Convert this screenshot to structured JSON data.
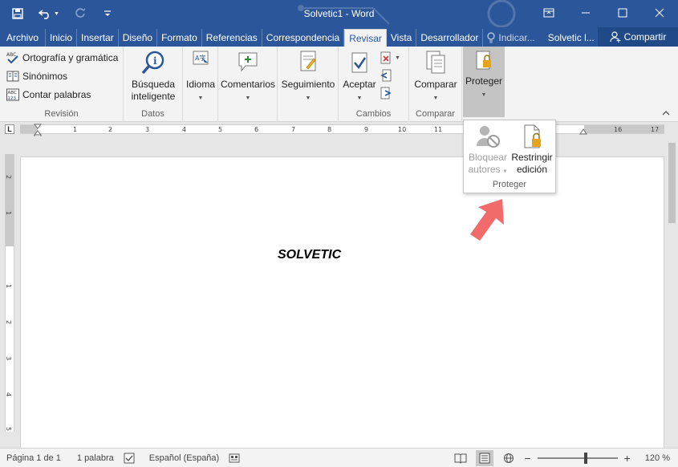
{
  "window": {
    "title": "Solvetic1 - Word"
  },
  "tabs": [
    {
      "label": "Archivo"
    },
    {
      "label": "Inicio"
    },
    {
      "label": "Insertar"
    },
    {
      "label": "Diseño"
    },
    {
      "label": "Formato"
    },
    {
      "label": "Referencias"
    },
    {
      "label": "Correspondencia"
    },
    {
      "label": "Revisar"
    },
    {
      "label": "Vista"
    },
    {
      "label": "Desarrollador"
    }
  ],
  "tell_me": "Indicar...",
  "user_name": "Solvetic l...",
  "share_label": "Compartir",
  "ribbon": {
    "revision": {
      "label": "Revisión",
      "spelling": "Ortografía y gramática",
      "synonyms": "Sinónimos",
      "word_count": "Contar palabras"
    },
    "datos": {
      "label": "Datos",
      "smart_lookup_1": "Búsqueda",
      "smart_lookup_2": "inteligente"
    },
    "language": "Idioma",
    "comments": "Comentarios",
    "tracking": "Seguimiento",
    "cambios": {
      "label": "Cambios",
      "accept": "Aceptar"
    },
    "comparar": {
      "label": "Comparar",
      "compare": "Comparar"
    },
    "protect": "Proteger"
  },
  "popup": {
    "block_1": "Bloquear",
    "block_2": "autores",
    "restrict_1": "Restringir",
    "restrict_2": "edición",
    "label": "Proteger"
  },
  "ruler_numbers": [
    "1",
    "2",
    "3",
    "4",
    "5",
    "6",
    "7",
    "8",
    "9",
    "10",
    "11",
    "16",
    "17"
  ],
  "vruler_numbers": [
    "2",
    "1",
    "1",
    "2",
    "3",
    "4",
    "5"
  ],
  "document": {
    "text": "SOLVETIC"
  },
  "status": {
    "page": "Página 1 de 1",
    "words": "1 palabra",
    "language": "Español (España)",
    "zoom": "120 %"
  },
  "colors": {
    "word_blue": "#2b579a",
    "arrow": "#f26b6b"
  }
}
